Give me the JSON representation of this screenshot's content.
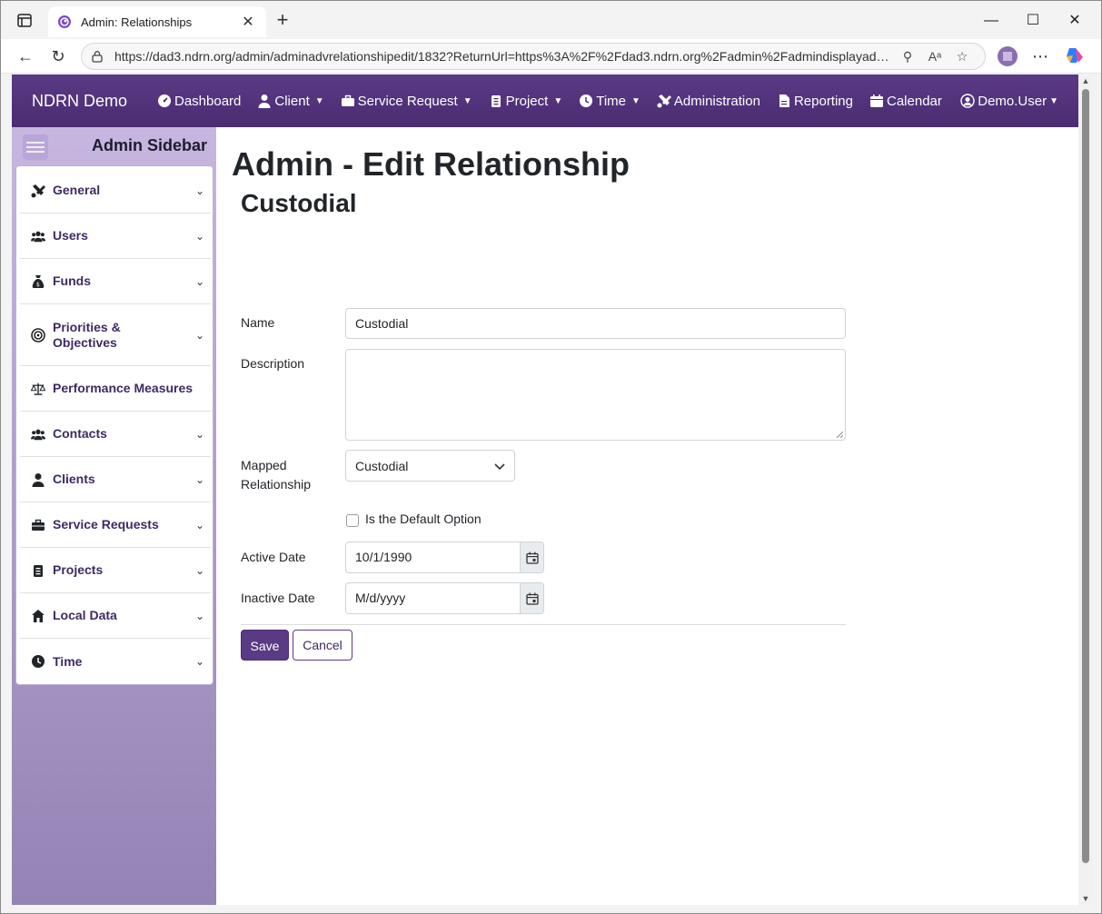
{
  "browser": {
    "tab_title": "Admin: Relationships",
    "tab_close": "✕",
    "new_tab": "+",
    "url": "https://dad3.ndrn.org/admin/adminadvrelationshipedit/1832?ReturnUrl=https%3A%2F%2Fdad3.ndrn.org%2Fadmin%2Fadmindisplayadvr..."
  },
  "navbar": {
    "brand": "NDRN Demo",
    "items": [
      {
        "label": "Dashboard",
        "icon": "dashboard-icon",
        "caret": false
      },
      {
        "label": "Client",
        "icon": "user-icon",
        "caret": true
      },
      {
        "label": "Service Request",
        "icon": "briefcase-icon",
        "caret": true
      },
      {
        "label": "Project",
        "icon": "clipboard-icon",
        "caret": true
      },
      {
        "label": "Time",
        "icon": "clock-icon",
        "caret": true
      },
      {
        "label": "Administration",
        "icon": "tools-icon",
        "caret": false
      },
      {
        "label": "Reporting",
        "icon": "file-icon",
        "caret": false
      },
      {
        "label": "Calendar",
        "icon": "calendar-icon",
        "caret": false
      }
    ],
    "user": "Demo.User"
  },
  "sidebar": {
    "title": "Admin Sidebar",
    "items": [
      {
        "label": "General",
        "icon": "tools-icon",
        "chevron": true
      },
      {
        "label": "Users",
        "icon": "users-icon",
        "chevron": true
      },
      {
        "label": "Funds",
        "icon": "money-bag-icon",
        "chevron": true
      },
      {
        "label": "Priorities & Objectives",
        "icon": "target-icon",
        "chevron": true
      },
      {
        "label": "Performance Measures",
        "icon": "scale-icon",
        "chevron": false
      },
      {
        "label": "Contacts",
        "icon": "users-icon",
        "chevron": true
      },
      {
        "label": "Clients",
        "icon": "user-icon",
        "chevron": true
      },
      {
        "label": "Service Requests",
        "icon": "briefcase-icon",
        "chevron": true
      },
      {
        "label": "Projects",
        "icon": "clipboard-icon",
        "chevron": true
      },
      {
        "label": "Local Data",
        "icon": "house-icon",
        "chevron": true
      },
      {
        "label": "Time",
        "icon": "clock-icon",
        "chevron": true
      }
    ]
  },
  "page": {
    "title": "Admin - Edit Relationship",
    "subtitle": "Custodial",
    "form": {
      "name_label": "Name",
      "name_value": "Custodial",
      "description_label": "Description",
      "description_value": "",
      "mapped_label": "Mapped Relationship",
      "mapped_value": "Custodial",
      "default_option_label": "Is the Default Option",
      "default_option_checked": false,
      "active_date_label": "Active Date",
      "active_date_value": "10/1/1990",
      "inactive_date_label": "Inactive Date",
      "inactive_date_placeholder": "M/d/yyyy"
    },
    "save_label": "Save",
    "cancel_label": "Cancel"
  },
  "colors": {
    "brand_purple": "#5a3a84",
    "sidebar_gradient_top": "#c7b6e0",
    "sidebar_gradient_bottom": "#9483b5"
  }
}
